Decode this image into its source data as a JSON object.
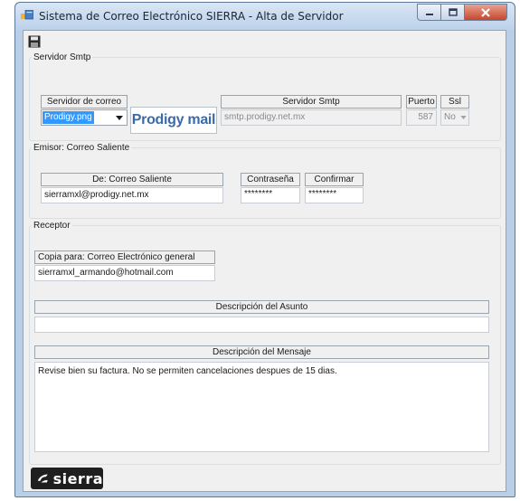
{
  "window": {
    "title": "Sistema de Correo Electrónico SIERRA - Alta de Servidor"
  },
  "toolbar": {
    "save_icon": "floppy-disk-icon"
  },
  "smtp": {
    "group_title": "Servidor Smtp",
    "mail_server_label": "Servidor de correo",
    "mail_server_value": "Prodigy.png",
    "logo_text": "Prodigy mail",
    "server_label": "Servidor Smtp",
    "server_value": "smtp.prodigy.net.mx",
    "port_label": "Puerto",
    "port_value": "587",
    "ssl_label": "Ssl",
    "ssl_value": "No"
  },
  "sender": {
    "group_title": "Emisor: Correo Saliente",
    "from_label": "De: Correo Saliente",
    "from_value": "sierramxl@prodigy.net.mx",
    "password_label": "Contraseña",
    "password_value": "********",
    "confirm_label": "Confirmar",
    "confirm_value": "********"
  },
  "receiver": {
    "group_title": "Receptor",
    "copy_label": "Copia para: Correo Electrónico general",
    "copy_value": "sierramxl_armando@hotmail.com",
    "subject_label": "Descripción del Asunto",
    "subject_value": "",
    "message_label": "Descripción del Mensaje",
    "message_value": "Revise bien su factura.  No se permiten cancelaciones despues de 15 dias."
  },
  "brand": {
    "name": "sierra"
  }
}
